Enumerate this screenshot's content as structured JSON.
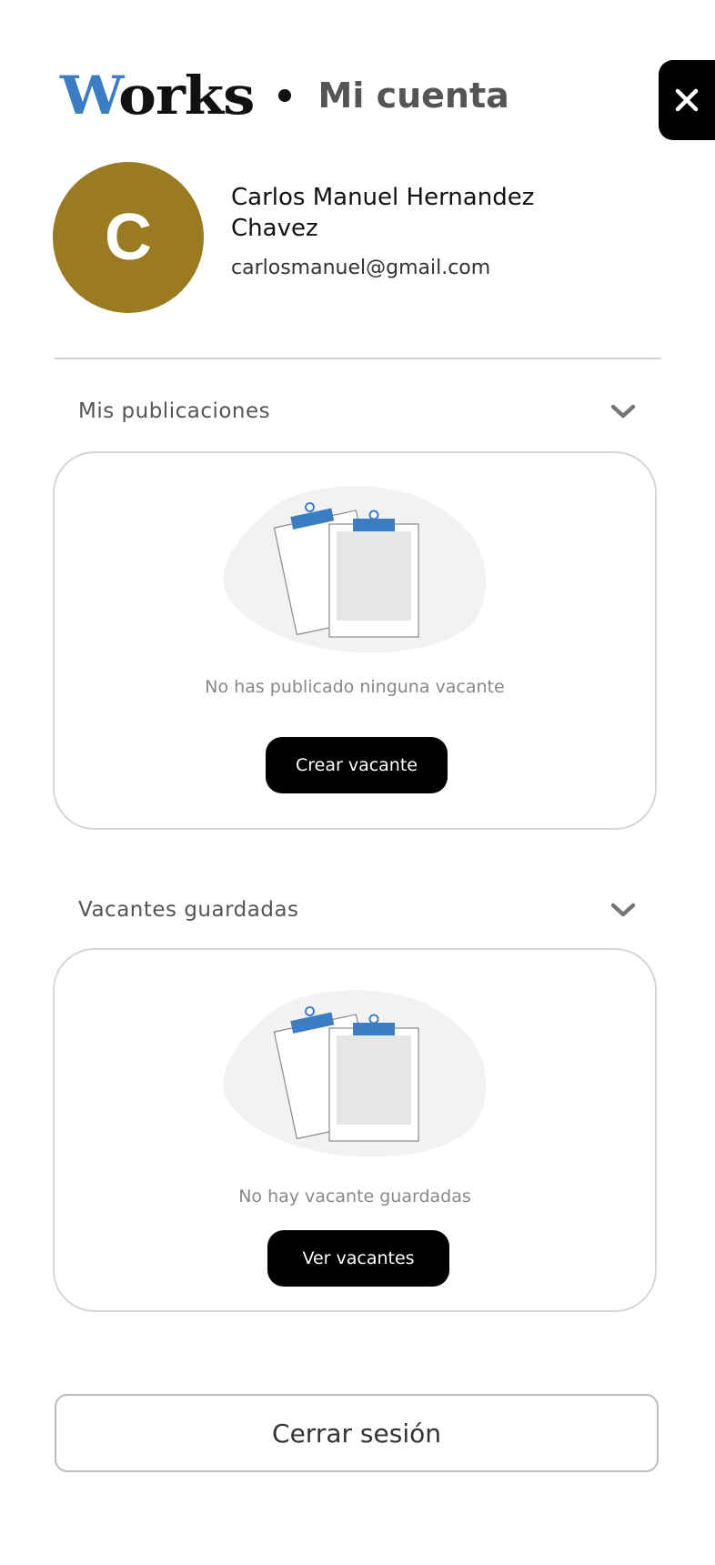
{
  "header": {
    "logo_first_letter": "W",
    "logo_rest": "orks",
    "title": "Mi cuenta"
  },
  "close_icon": "close-icon",
  "profile": {
    "avatar_letter": "C",
    "name": "Carlos Manuel Hernandez Chavez",
    "email": "carlosmanuel@gmail.com"
  },
  "sections": {
    "publicaciones": {
      "title": "Mis publicaciones",
      "empty_message": "No has publicado ninguna vacante",
      "button_label": "Crear vacante"
    },
    "guardadas": {
      "title": "Vacantes guardadas",
      "empty_message": "No hay vacante guardadas",
      "button_label": "Ver vacantes"
    }
  },
  "logout": {
    "label": "Cerrar sesión"
  },
  "colors": {
    "brand_blue": "#3a7dc4",
    "avatar_gold": "#9b7b21",
    "button_black": "#000000",
    "illustration_bg": "#f2f2f2"
  }
}
